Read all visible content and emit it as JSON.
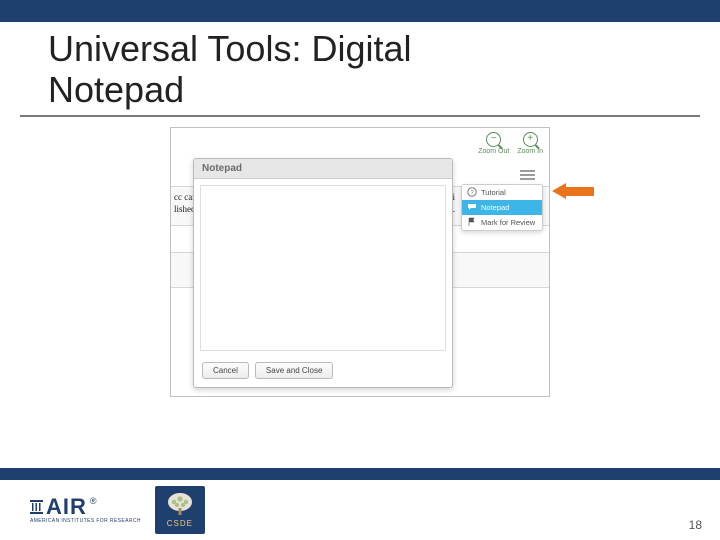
{
  "title_line1": "Universal Tools: Digital",
  "title_line2": "Notepad",
  "zoom": {
    "out": "Zoom Out",
    "in": "Zoom In"
  },
  "bg_text": {
    "left1": "cc can t",
    "left2": "lished",
    "right1": "bli",
    "right2": "att."
  },
  "notepad": {
    "header": "Notepad",
    "cancel": "Cancel",
    "save": "Save and Close"
  },
  "menu": {
    "tutorial": "Tutorial",
    "notepad": "Notepad",
    "mark": "Mark for Review"
  },
  "footer": {
    "air": "AIR",
    "air_sub": "AMERICAN INSTITUTES FOR RESEARCH",
    "csde": "CSDE",
    "page": "18"
  }
}
